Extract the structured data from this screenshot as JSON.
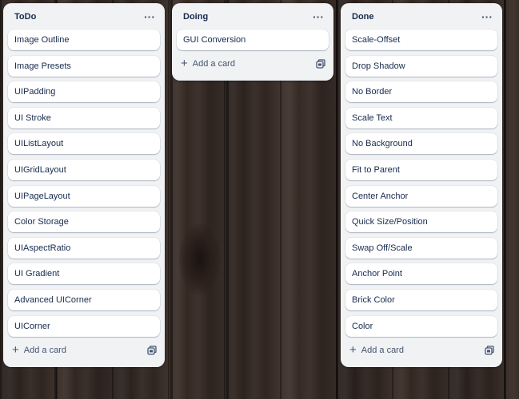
{
  "board": {
    "lists": [
      {
        "title": "ToDo",
        "menu_glyph": "···",
        "cards": [
          "Image Outline",
          "Image Presets",
          "UIPadding",
          "UI Stroke",
          "UIListLayout",
          "UIGridLayout",
          "UIPageLayout",
          "Color Storage",
          "UIAspectRatio",
          "UI Gradient",
          "Advanced UICorner",
          "UICorner"
        ],
        "add_label": "Add a card"
      },
      {
        "title": "Doing",
        "menu_glyph": "···",
        "cards": [
          "GUI Conversion"
        ],
        "add_label": "Add a card"
      },
      {
        "title": "Done",
        "menu_glyph": "···",
        "cards": [
          "Scale-Offset",
          "Drop Shadow",
          "No Border",
          "Scale Text",
          "No Background",
          "Fit to Parent",
          "Center Anchor",
          "Quick Size/Position",
          "Swap Off/Scale",
          "Anchor Point",
          "Brick Color",
          "Color"
        ],
        "add_label": "Add a card"
      }
    ]
  },
  "icons": {
    "menu": "more-horizontal-icon",
    "add": "plus-icon",
    "template": "card-template-icon"
  },
  "colors": {
    "list_bg": "#f1f2f4",
    "card_bg": "#ffffff",
    "text": "#172b4d",
    "muted_text": "#44546f"
  }
}
